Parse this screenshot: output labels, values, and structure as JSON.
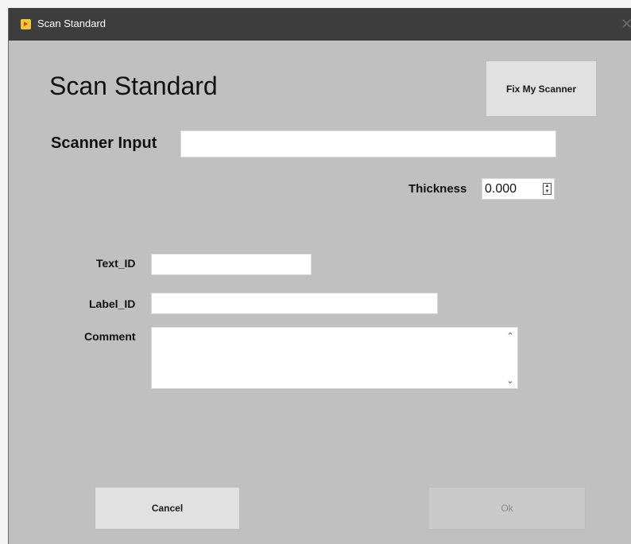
{
  "window": {
    "title": "Scan Standard"
  },
  "header": {
    "heading": "Scan Standard",
    "fix_scanner_label": "Fix My Scanner"
  },
  "form": {
    "scanner_input_label": "Scanner Input",
    "scanner_input_value": "",
    "thickness_label": "Thickness",
    "thickness_value": "0.000",
    "text_id_label": "Text_ID",
    "text_id_value": "",
    "label_id_label": "Label_ID",
    "label_id_value": "",
    "comment_label": "Comment",
    "comment_value": ""
  },
  "footer": {
    "cancel_label": "Cancel",
    "ok_label": "Ok"
  },
  "colors": {
    "dialog_background": "#c0c0c0",
    "titlebar": "#3d3d3d",
    "button_face": "#e1e1e1",
    "disabled_button_face": "#cacaca"
  }
}
